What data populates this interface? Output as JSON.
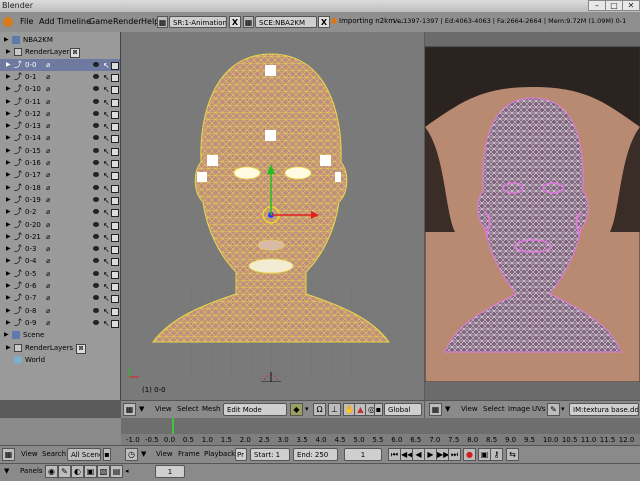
{
  "window": {
    "title": "Blender"
  },
  "menubar": {
    "items": [
      "File",
      "Add",
      "Timeline",
      "Game",
      "Render",
      "Help"
    ],
    "screen_field": "SR:1-Animation",
    "scene_field": "SCE:NBA2KM",
    "status": "Importing n2km ...",
    "stats": "Ve:1397-1397 | Ed:4063-4063 | Fa:2664-2664 | Mem:9.72M (1.09M) 0-1"
  },
  "outliner": {
    "root": "NBA2KM",
    "render_layers": "RenderLayers",
    "objects": [
      "0-0",
      "0-1",
      "0-10",
      "0-11",
      "0-12",
      "0-13",
      "0-14",
      "0-15",
      "0-16",
      "0-17",
      "0-18",
      "0-19",
      "0-2",
      "0-20",
      "0-21",
      "0-3",
      "0-4",
      "0-5",
      "0-6",
      "0-7",
      "0-8",
      "0-9"
    ],
    "scene": "Scene",
    "scene_render_layers": "RenderLayers",
    "world": "World"
  },
  "viewport3d": {
    "object_label": "(1) 0-0",
    "header": {
      "view": "View",
      "select": "Select",
      "mesh": "Mesh",
      "mode": "Edit Mode",
      "orientation": "Global"
    }
  },
  "uv_editor": {
    "header": {
      "view": "View",
      "select": "Select",
      "image": "Image",
      "uvs": "UVs",
      "image_name": "IM:textura base.dds"
    }
  },
  "timeline": {
    "ruler_ticks": [
      "-1.0",
      "-0.5",
      "0.0",
      "0.5",
      "1.0",
      "1.5",
      "2.0",
      "2.5",
      "3.0",
      "3.5",
      "4.0",
      "4.5",
      "5.0",
      "5.5",
      "6.0",
      "6.5",
      "7.0",
      "7.5",
      "8.0",
      "8.5",
      "9.0",
      "9.5",
      "10.0",
      "10.5",
      "11.0",
      "11.5",
      "12.0"
    ],
    "header": {
      "view": "View",
      "frame": "Frame",
      "playback": "Playback",
      "pr": "Pr",
      "start": "Start: 1",
      "end": "End: 250",
      "current": "1"
    },
    "left_header": {
      "view": "View",
      "search": "Search",
      "filter": "All Scenes"
    }
  },
  "bottom": {
    "panels": "Panels",
    "frame": "1"
  },
  "colors": {
    "bg": "#5a5a5a",
    "mesh_wire": "#e8d84a",
    "uv_wire": "#e079e0",
    "skin": "#c08d80",
    "selected_row": "#6e7aa0"
  }
}
